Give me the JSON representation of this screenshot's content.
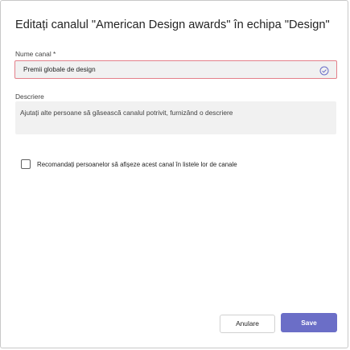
{
  "dialog": {
    "title": "Editați canalul \"American Design awards\" în echipa \"Design\""
  },
  "form": {
    "name_label": "Nume canal *",
    "name_value": "Premii globale de design",
    "name_status_icon": "check-circle-icon",
    "description_label": "Descriere",
    "description_placeholder": "Ajutați alte persoane să găsească canalul potrivit, furnizând o descriere",
    "recommend_checked": false,
    "recommend_label": "Recomandați persoanelor să afișeze acest canal în listele lor de canale"
  },
  "actions": {
    "cancel_label": "Anulare",
    "save_label": "Save"
  },
  "colors": {
    "accent": "#6b6ec7",
    "error_border": "#e3808a",
    "field_background": "#f1f1f1",
    "text": "#242424"
  }
}
